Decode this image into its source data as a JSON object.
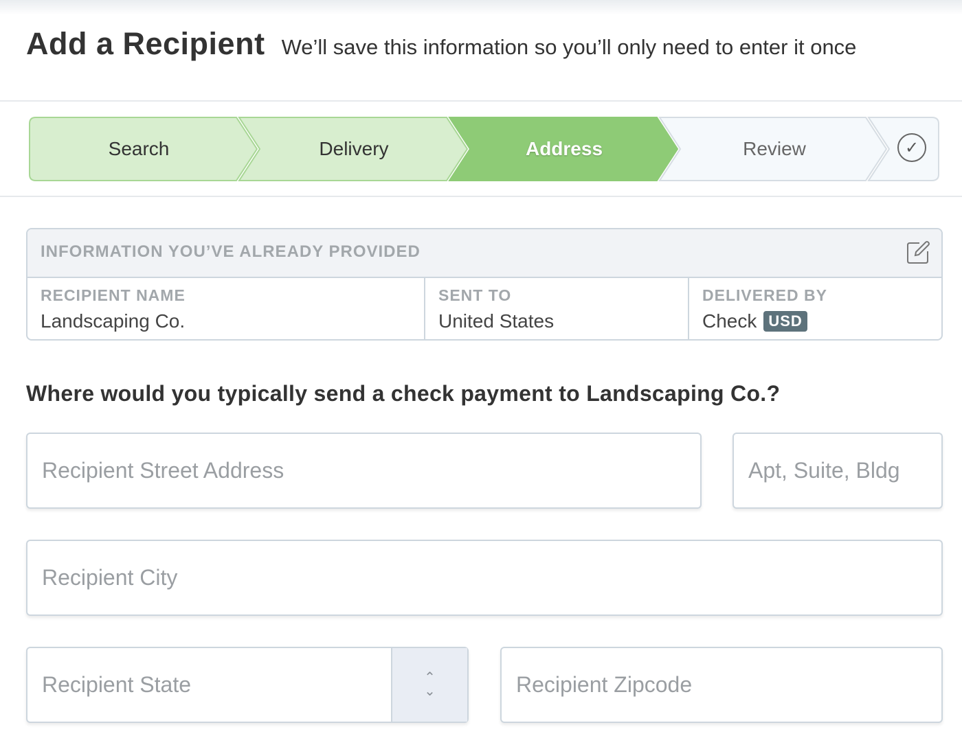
{
  "header": {
    "title": "Add a Recipient",
    "subtitle": "We’ll save this information so you’ll only need to enter it once"
  },
  "steps": [
    {
      "label": "Search",
      "state": "complete"
    },
    {
      "label": "Delivery",
      "state": "complete"
    },
    {
      "label": "Address",
      "state": "active"
    },
    {
      "label": "Review",
      "state": "upcoming"
    },
    {
      "label": "",
      "state": "upcoming",
      "icon": "check-circle-icon"
    }
  ],
  "colors": {
    "complete_bg": "#d8eecf",
    "active_bg": "#8ecb76",
    "upcoming_bg": "#f5f9fc",
    "border": "#cdd6de",
    "badge_bg": "#5d727b"
  },
  "check_glyph": "✓",
  "info": {
    "heading": "INFORMATION YOU’VE ALREADY PROVIDED",
    "edit_icon": "edit-icon",
    "cells": [
      {
        "label": "RECIPIENT NAME",
        "value": "Landscaping Co."
      },
      {
        "label": "SENT TO",
        "value": "United States"
      },
      {
        "label": "DELIVERED BY",
        "value": "Check",
        "badge": "USD"
      }
    ]
  },
  "question": "Where would you typically send a check payment to Landscaping Co.?",
  "form": {
    "street": {
      "placeholder": "Recipient Street Address",
      "value": ""
    },
    "apt": {
      "placeholder": "Apt, Suite, Bldg",
      "value": ""
    },
    "city": {
      "placeholder": "Recipient City",
      "value": ""
    },
    "state": {
      "placeholder": "Recipient State",
      "value": ""
    },
    "zip": {
      "placeholder": "Recipient Zipcode",
      "value": ""
    },
    "stepper_up": "⌃",
    "stepper_down": "⌄"
  }
}
